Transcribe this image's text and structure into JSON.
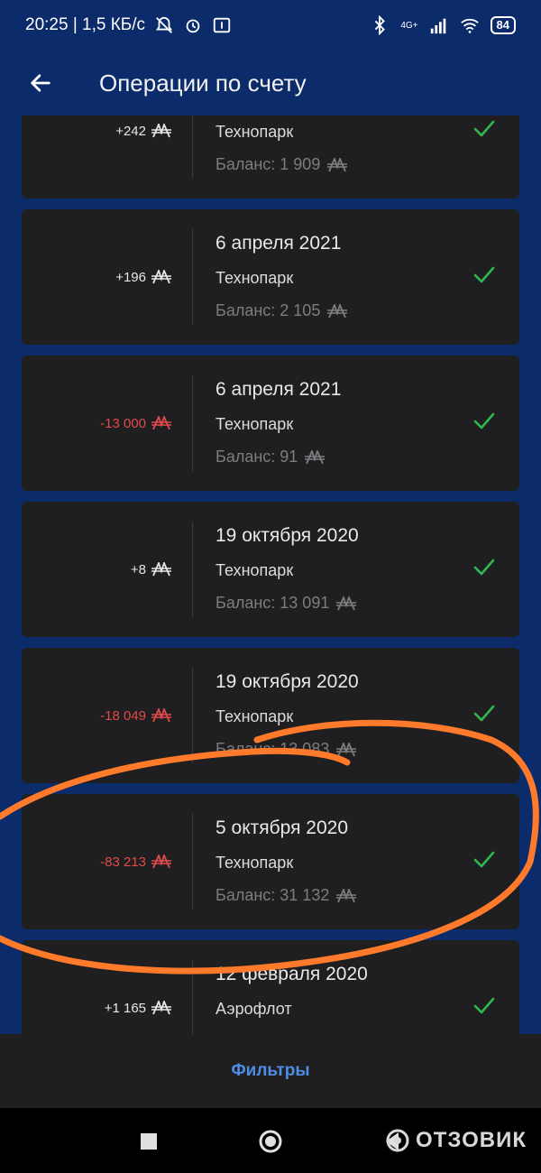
{
  "status_bar": {
    "time_speed": "20:25 | 1,5 КБ/с",
    "network": "4G+",
    "battery": "84"
  },
  "header": {
    "title": "Операции по счету",
    "back_icon": "arrow-left-icon"
  },
  "currency_icon": "miles-sign-icon",
  "transactions": [
    {
      "amount": "+242",
      "date": "",
      "merchant": "Технопарк",
      "balance": "Баланс: 1 909",
      "negative": false
    },
    {
      "amount": "+196",
      "date": "6 апреля 2021",
      "merchant": "Технопарк",
      "balance": "Баланс: 2 105",
      "negative": false
    },
    {
      "amount": "-13 000",
      "date": "6 апреля 2021",
      "merchant": "Технопарк",
      "balance": "Баланс: 91",
      "negative": true
    },
    {
      "amount": "+8",
      "date": "19 октября 2020",
      "merchant": "Технопарк",
      "balance": "Баланс: 13 091",
      "negative": false
    },
    {
      "amount": "-18 049",
      "date": "19 октября 2020",
      "merchant": "Технопарк",
      "balance": "Баланс: 13 083",
      "negative": true
    },
    {
      "amount": "-83 213",
      "date": "5 октября 2020",
      "merchant": "Технопарк",
      "balance": "Баланс: 31 132",
      "negative": true
    },
    {
      "amount": "+1 165",
      "date": "12 февраля 2020",
      "merchant": "Аэрофлот",
      "balance": "",
      "negative": false
    }
  ],
  "bottom": {
    "filters_label": "Фильтры"
  },
  "watermark": "ОТЗОВИК",
  "colors": {
    "background": "#0b2b6b",
    "card": "#1f1f21",
    "negative": "#e04a4a",
    "check": "#2eb84f",
    "link": "#4d8de3",
    "annotation": "#ff7a2a"
  }
}
